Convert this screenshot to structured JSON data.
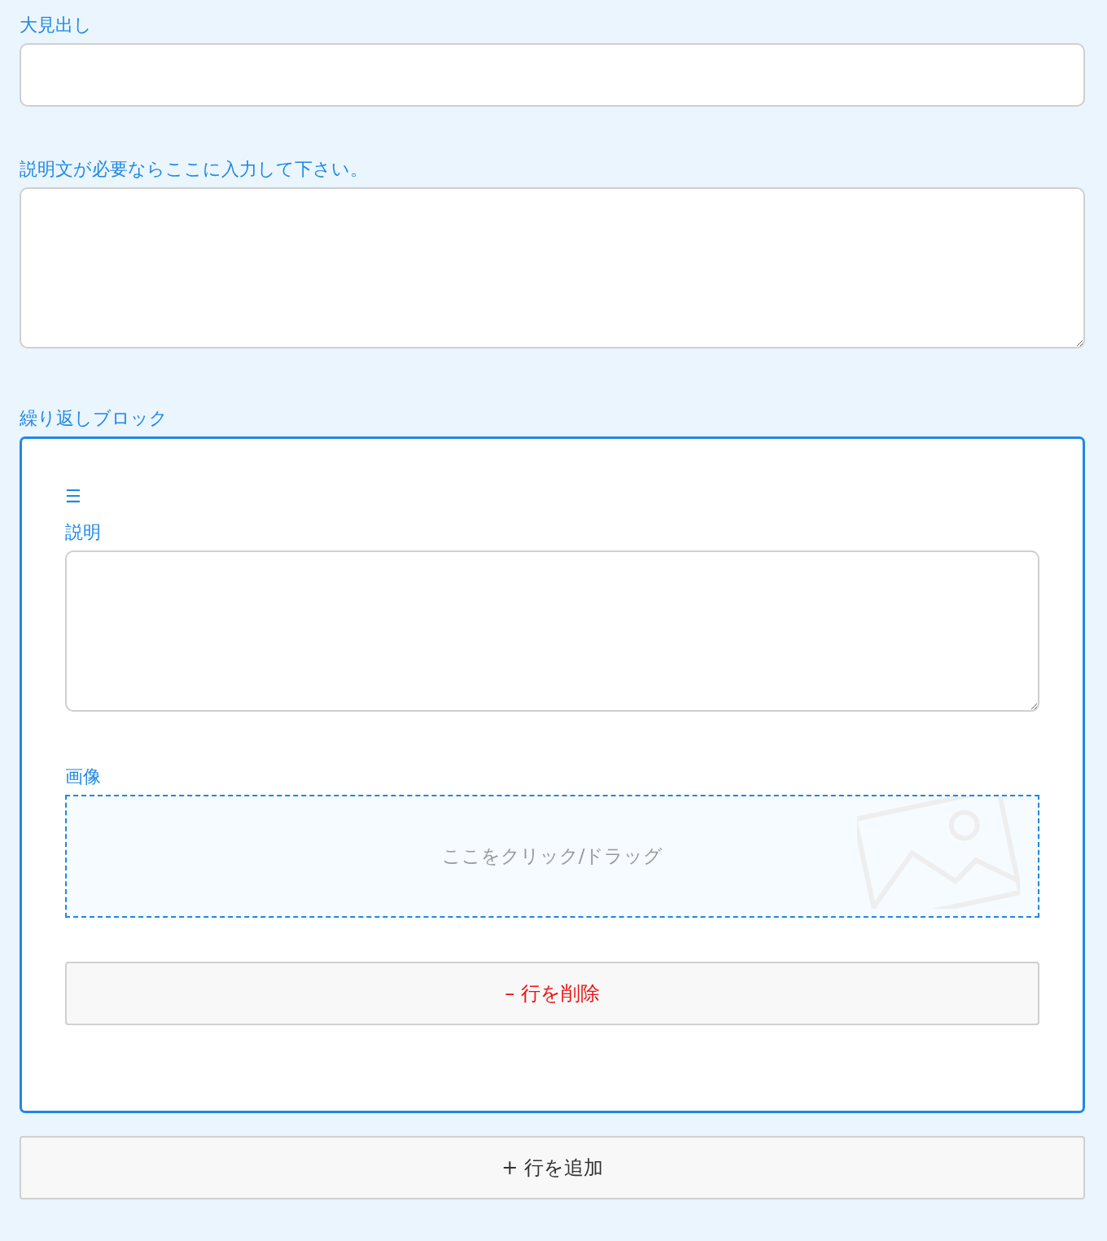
{
  "fields": [
    {
      "kind": "input",
      "label": "大見出し"
    },
    {
      "kind": "textarea",
      "label": "説明文が必要ならここに入力して下さい。"
    }
  ],
  "repeat_block": {
    "label": "繰り返しブロック",
    "rows": [
      {
        "handle": "☰",
        "fields": [
          {
            "kind": "textarea",
            "label": "説明"
          },
          {
            "kind": "image",
            "label": "画像",
            "prompt": "ここをクリック/ドラッグ"
          }
        ],
        "delete_button": "– 行を削除"
      }
    ],
    "add_button": "+ 行を追加"
  }
}
